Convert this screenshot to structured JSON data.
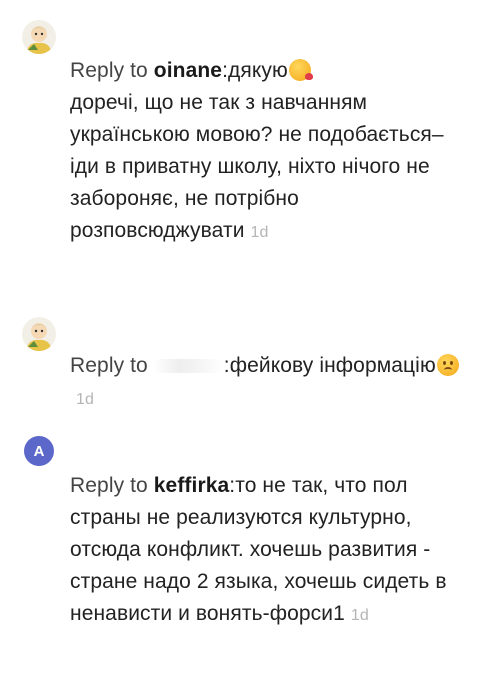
{
  "comments": [
    {
      "avatar": "user-avatar-cartoon",
      "reply_prefix": "Reply to ",
      "reply_username": "oinane",
      "text": ":дякую",
      "emoji": "kissing-heart-emoji",
      "continuation": "доречі, що не так з навчанням українською мовою? не подобається– іди в приватну школу, ніхто нічого не забороняє, не потрібно розповсюджувати",
      "timestamp": "1d"
    },
    {
      "avatar": "user-avatar-cartoon",
      "reply_prefix": "Reply to ",
      "reply_username_redacted": true,
      "text": ":фейкову інформацію",
      "emoji": "sad-face-emoji",
      "timestamp": "1d"
    },
    {
      "avatar_letter": "A",
      "avatar_color": "#5b68c9",
      "reply_prefix": "Reply to ",
      "reply_username": "keffirka",
      "text": ":то не так, что пол страны не реализуются культурно, отсюда конфликт. хочешь развития - стране надо 2 языка, хочешь сидеть в ненависти и вонять-форси1",
      "timestamp": "1d"
    }
  ]
}
